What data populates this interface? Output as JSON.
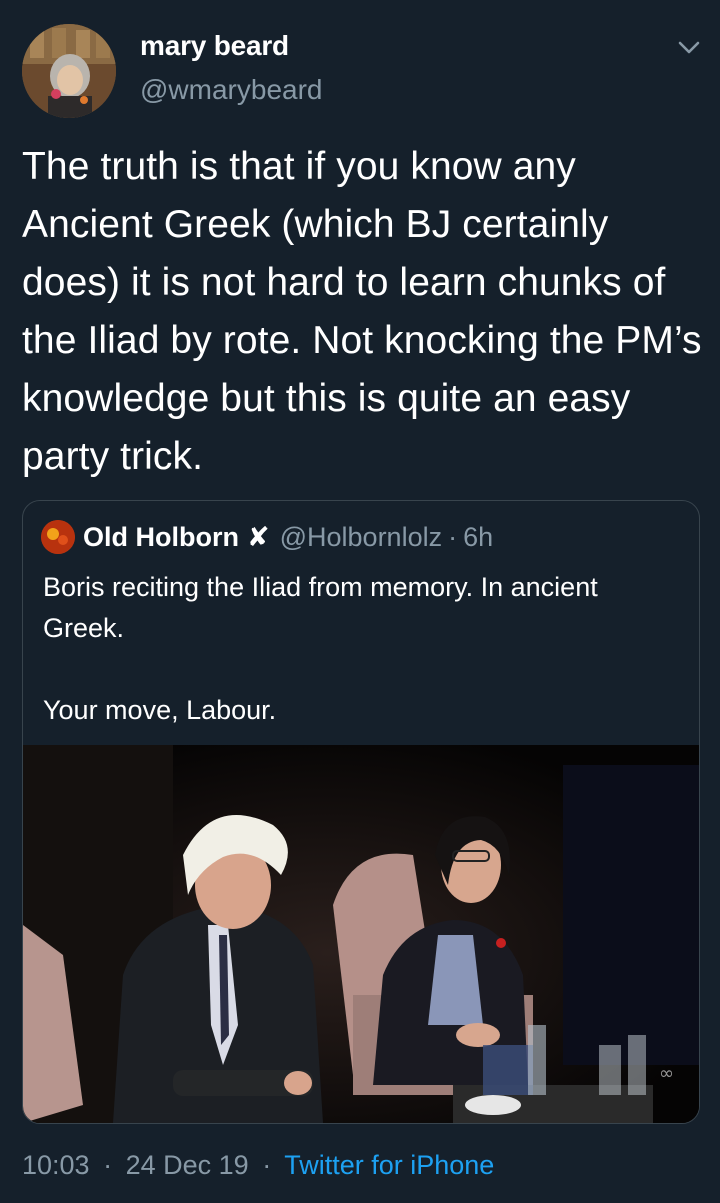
{
  "tweet": {
    "author_name": "mary beard",
    "author_handle": "@wmarybeard",
    "text": "The truth is that if you know any Ancient Greek (which BJ certainly does) it is not hard to learn chunks of the Iliad by rote. Not knocking the PM’s knowledge but this is quite an easy party trick.",
    "time": "10:03",
    "separator": "·",
    "date": "24 Dec 19",
    "source": "Twitter for iPhone"
  },
  "quoted_tweet": {
    "author_name": "Old Holborn",
    "author_badge": "✘",
    "author_handle": "@Holbornlolz",
    "separator": "·",
    "age": "6h",
    "text": "Boris reciting the Iliad from memory. In ancient Greek.\n\nYour move, Labour."
  },
  "icons": {
    "menu": "chevron-down-icon",
    "avatar": "avatar",
    "media": "video-thumbnail"
  },
  "colors": {
    "background": "#15202b",
    "secondary_text": "#8899a6",
    "link": "#1da1f2",
    "border": "#38444d"
  }
}
